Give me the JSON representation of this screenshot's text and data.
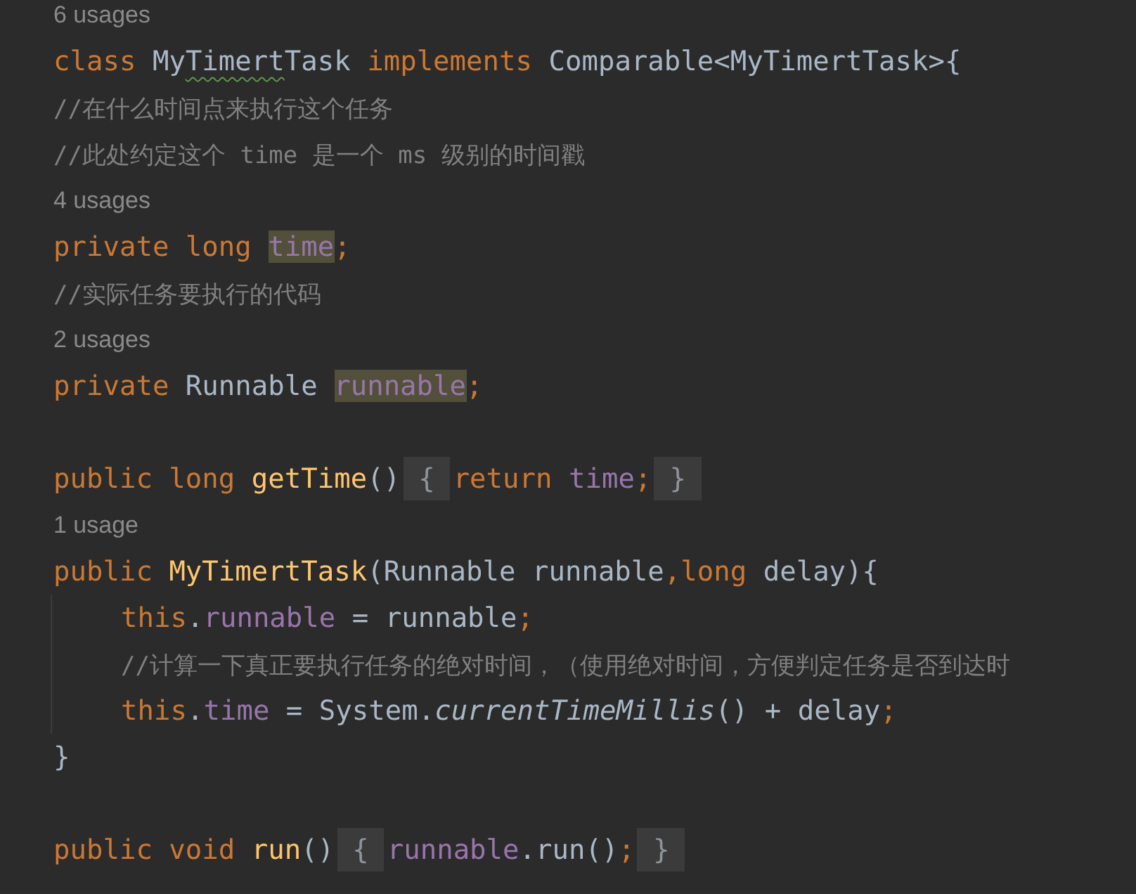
{
  "lines": [
    {
      "kind": "hint",
      "text": "6 usages"
    },
    {
      "kind": "code",
      "tokens": [
        {
          "kind": "keyword",
          "text": "class "
        },
        {
          "kind": "plain",
          "text": "My"
        },
        {
          "kind": "plain",
          "text": "Timert",
          "typo": true
        },
        {
          "kind": "plain",
          "text": "Task "
        },
        {
          "kind": "keyword",
          "text": "implements"
        },
        {
          "kind": "plain",
          "text": " Comparable<MyTimertTask>{"
        }
      ]
    },
    {
      "kind": "code",
      "tokens": [
        {
          "kind": "comment",
          "text": "//在什么时间点来执行这个任务"
        }
      ]
    },
    {
      "kind": "code",
      "tokens": [
        {
          "kind": "comment",
          "text": "//此处约定这个 time 是一个 ms 级别的时间戳"
        }
      ]
    },
    {
      "kind": "hint",
      "text": "4 usages"
    },
    {
      "kind": "code",
      "tokens": [
        {
          "kind": "keyword",
          "text": "private long "
        },
        {
          "kind": "field",
          "text": "time",
          "marked": true
        },
        {
          "kind": "keyword",
          "text": ";"
        }
      ]
    },
    {
      "kind": "code",
      "tokens": [
        {
          "kind": "comment",
          "text": "//实际任务要执行的代码"
        }
      ]
    },
    {
      "kind": "hint",
      "text": "2 usages"
    },
    {
      "kind": "code",
      "tokens": [
        {
          "kind": "keyword",
          "text": "private "
        },
        {
          "kind": "plain",
          "text": "Runnable "
        },
        {
          "kind": "field",
          "text": "runnable",
          "marked": true
        },
        {
          "kind": "keyword",
          "text": ";"
        }
      ]
    },
    {
      "kind": "blank"
    },
    {
      "kind": "code",
      "tokens": [
        {
          "kind": "keyword",
          "text": "public long "
        },
        {
          "kind": "method",
          "text": "getTime"
        },
        {
          "kind": "plain",
          "text": "()"
        },
        {
          "kind": "plain",
          "text": "{",
          "folded": true
        },
        {
          "kind": "keyword",
          "text": "return "
        },
        {
          "kind": "field",
          "text": "time"
        },
        {
          "kind": "keyword",
          "text": ";"
        },
        {
          "kind": "plain",
          "text": "}",
          "folded": true
        }
      ]
    },
    {
      "kind": "hint",
      "text": "1 usage"
    },
    {
      "kind": "code",
      "tokens": [
        {
          "kind": "keyword",
          "text": "public "
        },
        {
          "kind": "method",
          "text": "MyTimertTask"
        },
        {
          "kind": "plain",
          "text": "(Runnable runnable"
        },
        {
          "kind": "keyword",
          "text": ",long"
        },
        {
          "kind": "plain",
          "text": " delay){"
        }
      ],
      "children": [
        {
          "kind": "code",
          "tokens": [
            {
              "kind": "keyword",
              "text": "this"
            },
            {
              "kind": "plain",
              "text": "."
            },
            {
              "kind": "field",
              "text": "runnable"
            },
            {
              "kind": "plain",
              "text": " = runnable"
            },
            {
              "kind": "keyword",
              "text": ";"
            }
          ]
        },
        {
          "kind": "code",
          "tokens": [
            {
              "kind": "comment",
              "text": "//计算一下真正要执行任务的绝对时间，（使用绝对时间，方便判定任务是否到达时"
            }
          ]
        },
        {
          "kind": "code",
          "tokens": [
            {
              "kind": "keyword",
              "text": "this"
            },
            {
              "kind": "plain",
              "text": "."
            },
            {
              "kind": "field",
              "text": "time"
            },
            {
              "kind": "plain",
              "text": " = System."
            },
            {
              "kind": "static",
              "text": "currentTimeMillis"
            },
            {
              "kind": "plain",
              "text": "() + delay"
            },
            {
              "kind": "keyword",
              "text": ";"
            }
          ]
        }
      ]
    },
    {
      "kind": "code",
      "tokens": [
        {
          "kind": "plain",
          "text": "}"
        }
      ]
    },
    {
      "kind": "blank"
    },
    {
      "kind": "code",
      "tokens": [
        {
          "kind": "keyword",
          "text": "public void "
        },
        {
          "kind": "method",
          "text": "run"
        },
        {
          "kind": "plain",
          "text": "()"
        },
        {
          "kind": "plain",
          "text": "{",
          "folded": true
        },
        {
          "kind": "field",
          "text": "runnable"
        },
        {
          "kind": "plain",
          "text": ".run()"
        },
        {
          "kind": "keyword",
          "text": ";"
        },
        {
          "kind": "plain",
          "text": "}",
          "folded": true
        }
      ]
    }
  ]
}
